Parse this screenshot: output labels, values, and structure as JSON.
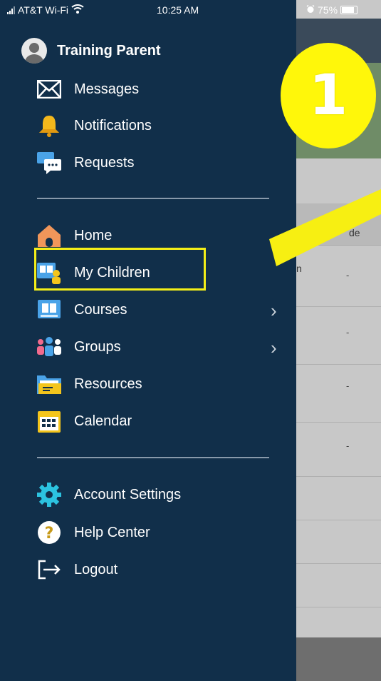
{
  "status_bar": {
    "carrier": "AT&T Wi-Fi",
    "time": "10:25 AM",
    "battery": "75%"
  },
  "drawer": {
    "profile_name": "Training Parent",
    "section1": [
      {
        "label": "Messages",
        "icon": "envelope-icon"
      },
      {
        "label": "Notifications",
        "icon": "bell-icon"
      },
      {
        "label": "Requests",
        "icon": "chat-bubble-icon"
      }
    ],
    "section2": [
      {
        "label": "Home",
        "icon": "home-icon"
      },
      {
        "label": "My Children",
        "icon": "children-icon"
      },
      {
        "label": "Courses",
        "icon": "courses-icon"
      },
      {
        "label": "Groups",
        "icon": "groups-icon"
      },
      {
        "label": "Resources",
        "icon": "folder-icon"
      },
      {
        "label": "Calendar",
        "icon": "calendar-icon"
      }
    ],
    "section3": [
      {
        "label": "Account Settings",
        "icon": "gear-icon"
      },
      {
        "label": "Help Center",
        "icon": "help-icon"
      },
      {
        "label": "Logout",
        "icon": "logout-icon"
      }
    ]
  },
  "background": {
    "column_header_fragment": "de",
    "text_fragment": "n",
    "cell_value": "-"
  },
  "annotation": {
    "step_number": "1",
    "color": "#fff70a"
  },
  "colors": {
    "drawer_bg": "#112f4a",
    "highlight": "#f3ee18"
  }
}
